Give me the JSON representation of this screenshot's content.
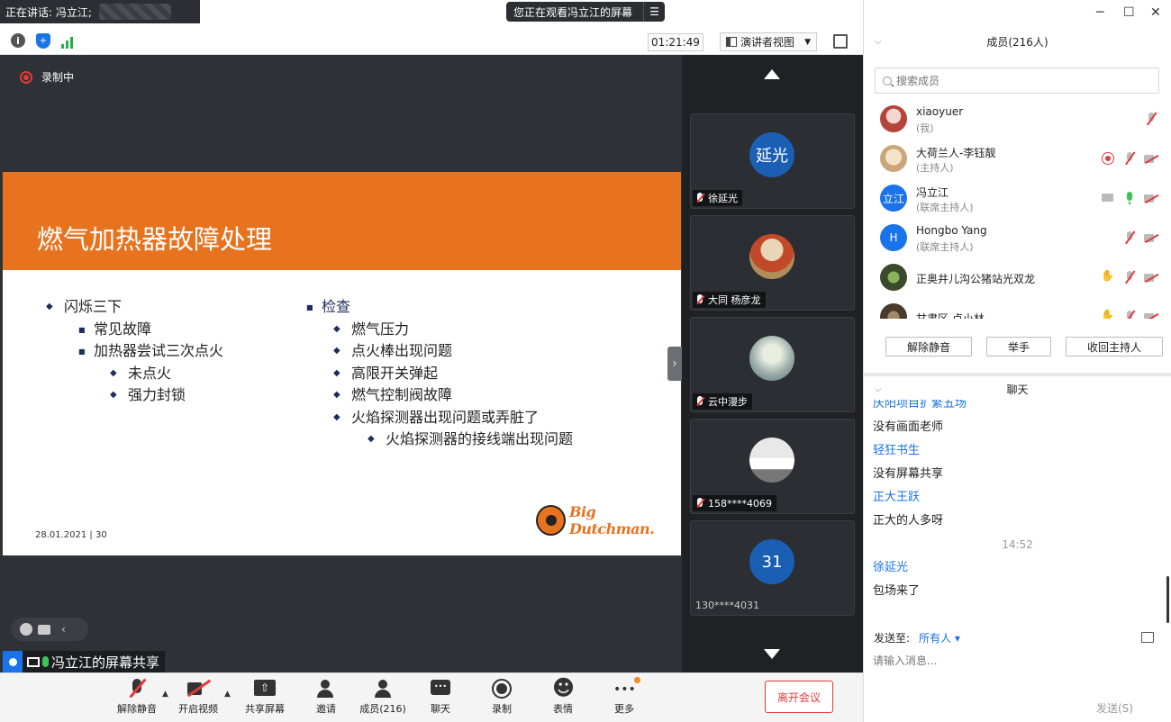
{
  "top": {
    "speaking": "正在讲话: 冯立江;",
    "viewing": "您正在观看冯立江的屏幕",
    "timer": "01:21:49",
    "view_mode": "演讲者视图"
  },
  "stage": {
    "recording": "录制中",
    "share_label": "冯立江的屏幕共享"
  },
  "slide": {
    "title": "燃气加热器故障处理",
    "left": [
      {
        "level": 1,
        "text": "闪烁三下"
      },
      {
        "level": 2,
        "text": "常见故障"
      },
      {
        "level": 2,
        "text": "加热器尝试三次点火"
      },
      {
        "level": 3,
        "text": "未点火"
      },
      {
        "level": 3,
        "text": "强力封锁"
      }
    ],
    "right_head": "检查",
    "right": [
      {
        "level": 2,
        "text": "燃气压力"
      },
      {
        "level": 2,
        "text": "点火棒出现问题"
      },
      {
        "level": 2,
        "text": "高限开关弹起"
      },
      {
        "level": 2,
        "text": "燃气控制阀故障"
      },
      {
        "level": 2,
        "text": "火焰探测器出现问题或弄脏了"
      },
      {
        "level": 3,
        "text": "火焰探测器的接线端出现问题"
      }
    ],
    "footer": "28.01.2021  |  30",
    "logo": "Big Dutchman."
  },
  "strip": {
    "tiles": [
      {
        "avatar_text": "延光",
        "avatar_color": "#1a5fb4",
        "name": "徐延光",
        "muted": true
      },
      {
        "avatar_text": "",
        "avatar_color": "#d9c7a3",
        "name": "大同 杨彦龙",
        "muted": true
      },
      {
        "avatar_text": "",
        "avatar_color": "#9fb1ad",
        "name": "云中漫步",
        "muted": true
      },
      {
        "avatar_text": "",
        "avatar_color": "#c9c9c9",
        "name": "158****4069",
        "muted": true
      },
      {
        "avatar_text": "31",
        "avatar_color": "#1a5fb4",
        "name": "130****4031",
        "muted": false
      }
    ]
  },
  "toolbar": {
    "unmute": "解除静音",
    "video": "开启视频",
    "share": "共享屏幕",
    "invite": "邀请",
    "members": "成员(216)",
    "chat": "聊天",
    "record": "录制",
    "reactions": "表情",
    "more": "更多",
    "leave": "离开会议"
  },
  "panel": {
    "members_title": "成员(216人)",
    "search_placeholder": "搜索成员",
    "members": [
      {
        "name": "xiaoyuer",
        "role": "(我)",
        "avatar_text": "",
        "avatar_color": "#d98a8a",
        "icons": [
          "mic-off"
        ]
      },
      {
        "name": "大荷兰人-李钰靓",
        "role": "(主持人)",
        "avatar_text": "",
        "avatar_color": "#e8d0b0",
        "icons": [
          "rec",
          "mic-off",
          "cam-off"
        ]
      },
      {
        "name": "冯立江",
        "role": "(联席主持人)",
        "avatar_text": "立江",
        "avatar_color": "#1a73e8",
        "icons": [
          "screen",
          "mic-on",
          "cam-off"
        ]
      },
      {
        "name": "Hongbo Yang",
        "role": "(联席主持人)",
        "avatar_text": "H",
        "avatar_color": "#1a73e8",
        "icons": [
          "mic-off",
          "cam-off"
        ]
      },
      {
        "name": "正奥井儿沟公猪站光双龙",
        "role": "",
        "avatar_text": "",
        "avatar_color": "#4b6b3a",
        "icons": [
          "hand",
          "mic-off",
          "cam-off"
        ]
      },
      {
        "name": "甘肃区 卢小林",
        "role": "",
        "avatar_text": "",
        "avatar_color": "#5a4a3a",
        "icons": [
          "hand",
          "mic-off",
          "cam-off"
        ]
      }
    ],
    "unmute_all": "解除静音",
    "raise_hand": "举手",
    "reclaim_host": "收回主持人",
    "chat_title": "聊天",
    "chat": [
      {
        "type": "sender",
        "text": "庆阳项目扩繁五场"
      },
      {
        "type": "text",
        "text": "没有画面老师"
      },
      {
        "type": "sender",
        "text": "轻狂书生"
      },
      {
        "type": "text",
        "text": "没有屏幕共享"
      },
      {
        "type": "sender",
        "text": "正大王跃"
      },
      {
        "type": "text",
        "text": "正大的人多呀"
      },
      {
        "type": "time",
        "text": "14:52"
      },
      {
        "type": "sender",
        "text": "徐延光"
      },
      {
        "type": "text",
        "text": "包场来了"
      }
    ],
    "send_to_label": "发送至:",
    "send_to_value": "所有人",
    "input_placeholder": "请输入消息...",
    "send_label": "发送(S)"
  }
}
